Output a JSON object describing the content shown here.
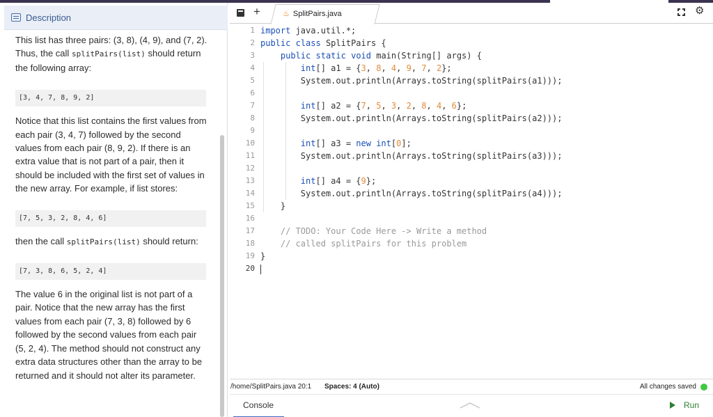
{
  "description": {
    "header": "Description",
    "p1": "This list has three pairs: (3, 8), (4, 9), and (7, 2). Thus, the call",
    "p1_code": "splitPairs(list)",
    "p1_tail": "should return the following array:",
    "code1": "[3, 4, 7, 8, 9, 2]",
    "p2": "Notice that this list contains the first values from each pair (3, 4, 7) followed by the second values from each pair (8, 9, 2). If there is an extra value that is not part of a pair, then it should be included with the first set of values in the new array. For example, if list stores:",
    "code2": "[7, 5, 3, 2, 8, 4, 6]",
    "p3_pre": "then the call",
    "p3_code": "splitPairs(list)",
    "p3_tail": "should return:",
    "code3": "[7, 3, 8, 6, 5, 2, 4]",
    "p4": "The value 6 in the original list is not part of a pair. Notice that the new array has the first values from each pair (7, 3, 8) followed by 6 followed by the second values from each pair (5, 2, 4). The method should not construct any extra data structures other than the array to be returned and it should not alter its parameter."
  },
  "editor": {
    "add_tab": "+",
    "tab_name": "SplitPairs.java",
    "line_numbers": [
      "1",
      "2",
      "3",
      "4",
      "5",
      "6",
      "7",
      "8",
      "9",
      "10",
      "11",
      "12",
      "13",
      "14",
      "15",
      "16",
      "17",
      "18",
      "19",
      "20"
    ]
  },
  "status": {
    "path": "/home/SplitPairs.java  20:1",
    "spaces": "Spaces: 4 (Auto)",
    "saved": "All changes saved"
  },
  "console": {
    "tab": "Console",
    "run": "Run"
  },
  "icons": {
    "description": "description-icon",
    "new_file": "new-file-icon",
    "java": "java-icon",
    "fullscreen": "fullscreen-icon",
    "settings": "gear-icon",
    "run": "play-icon"
  },
  "colors": {
    "keyword": "#1a4fb5",
    "number": "#e08a3c",
    "comment": "#999999",
    "saved_dot": "#42c842",
    "run": "#2e7d32",
    "accent_bar": "#3b3450"
  }
}
